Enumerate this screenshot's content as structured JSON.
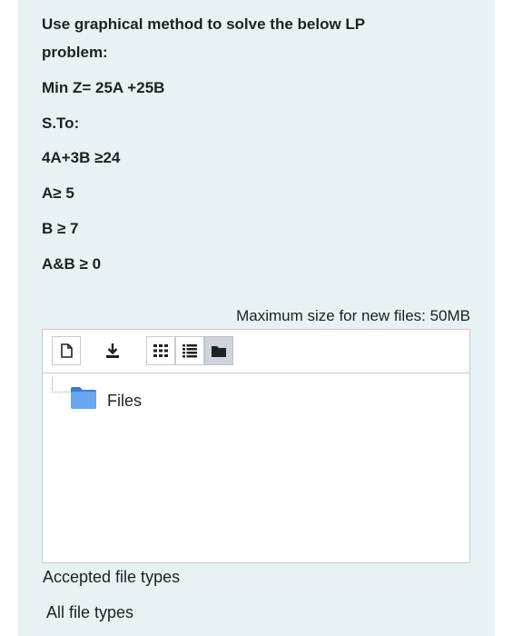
{
  "question": {
    "line1": "Use graphical method to solve the below LP",
    "line2": "problem:",
    "objective": "Min Z= 25A +25B",
    "subject_to": "S.To:",
    "constraint1": "4A+3B ≥24",
    "constraint2": "A≥ 5",
    "constraint3": "B ≥ 7",
    "constraint4": "A&B ≥ 0"
  },
  "filemanager": {
    "max_size": "Maximum size for new files: 50MB",
    "toolbar": {
      "icons": [
        "add-file-icon",
        "download-icon",
        "icon-view-icon",
        "list-view-icon",
        "folder-view-icon"
      ]
    },
    "folder_label": "Files"
  },
  "accepted": {
    "label": "Accepted file types",
    "value": "All file types"
  },
  "colors": {
    "panel_bg": "#e8f1f3",
    "folder_blue": "#4f8fdc",
    "border": "#c7ccd0",
    "text": "#1d2125"
  }
}
